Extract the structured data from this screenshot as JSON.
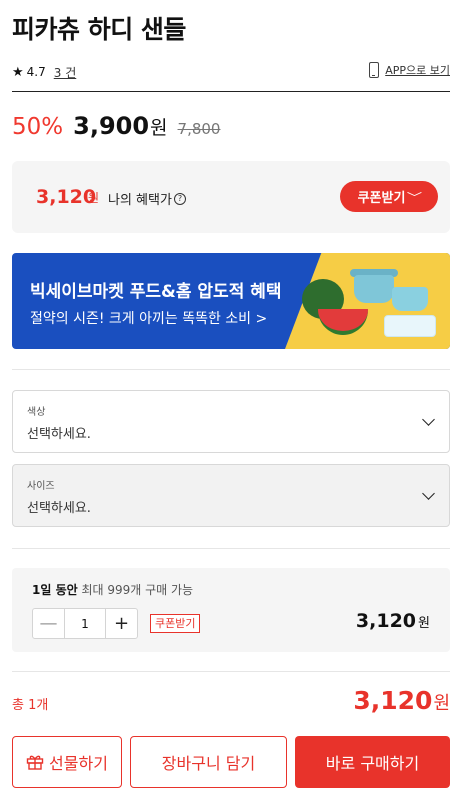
{
  "product": {
    "title": "피카츄 하디 샌들",
    "rating": "4.7",
    "review_count": "3 건",
    "app_link": "APP으로 보기"
  },
  "pricing": {
    "discount": "50%",
    "price": "3,900",
    "price_unit": "원",
    "original": "7,800"
  },
  "benefit": {
    "price": "3,120",
    "unit": "원",
    "label": "나의 혜택가",
    "help": "?",
    "coupon_label": "쿠폰받기",
    "coupon_chevron": "﹀"
  },
  "banner": {
    "title": "빅세이브마켓 푸드&홈 압도적 혜택",
    "subtitle": "절약의 시즌! 크게 아끼는 똑똑한 소비 >"
  },
  "options": [
    {
      "label": "색상",
      "value": "선택하세요."
    },
    {
      "label": "사이즈",
      "value": "선택하세요."
    }
  ],
  "quantity": {
    "info_bold": "1일 동안",
    "info_rest": " 최대 999개 구매 가능",
    "minus": "—",
    "value": "1",
    "plus": "+",
    "coupon": "쿠폰받기",
    "line_price": "3,120",
    "line_unit": "원"
  },
  "total": {
    "label": "총 1개",
    "price": "3,120",
    "unit": "원"
  },
  "actions": {
    "gift": "선물하기",
    "cart": "장바구니 담기",
    "buy": "바로 구매하기"
  },
  "colors": {
    "accent": "#e8332b",
    "banner_blue": "#1a4fbf",
    "banner_yellow": "#f6cd45"
  }
}
